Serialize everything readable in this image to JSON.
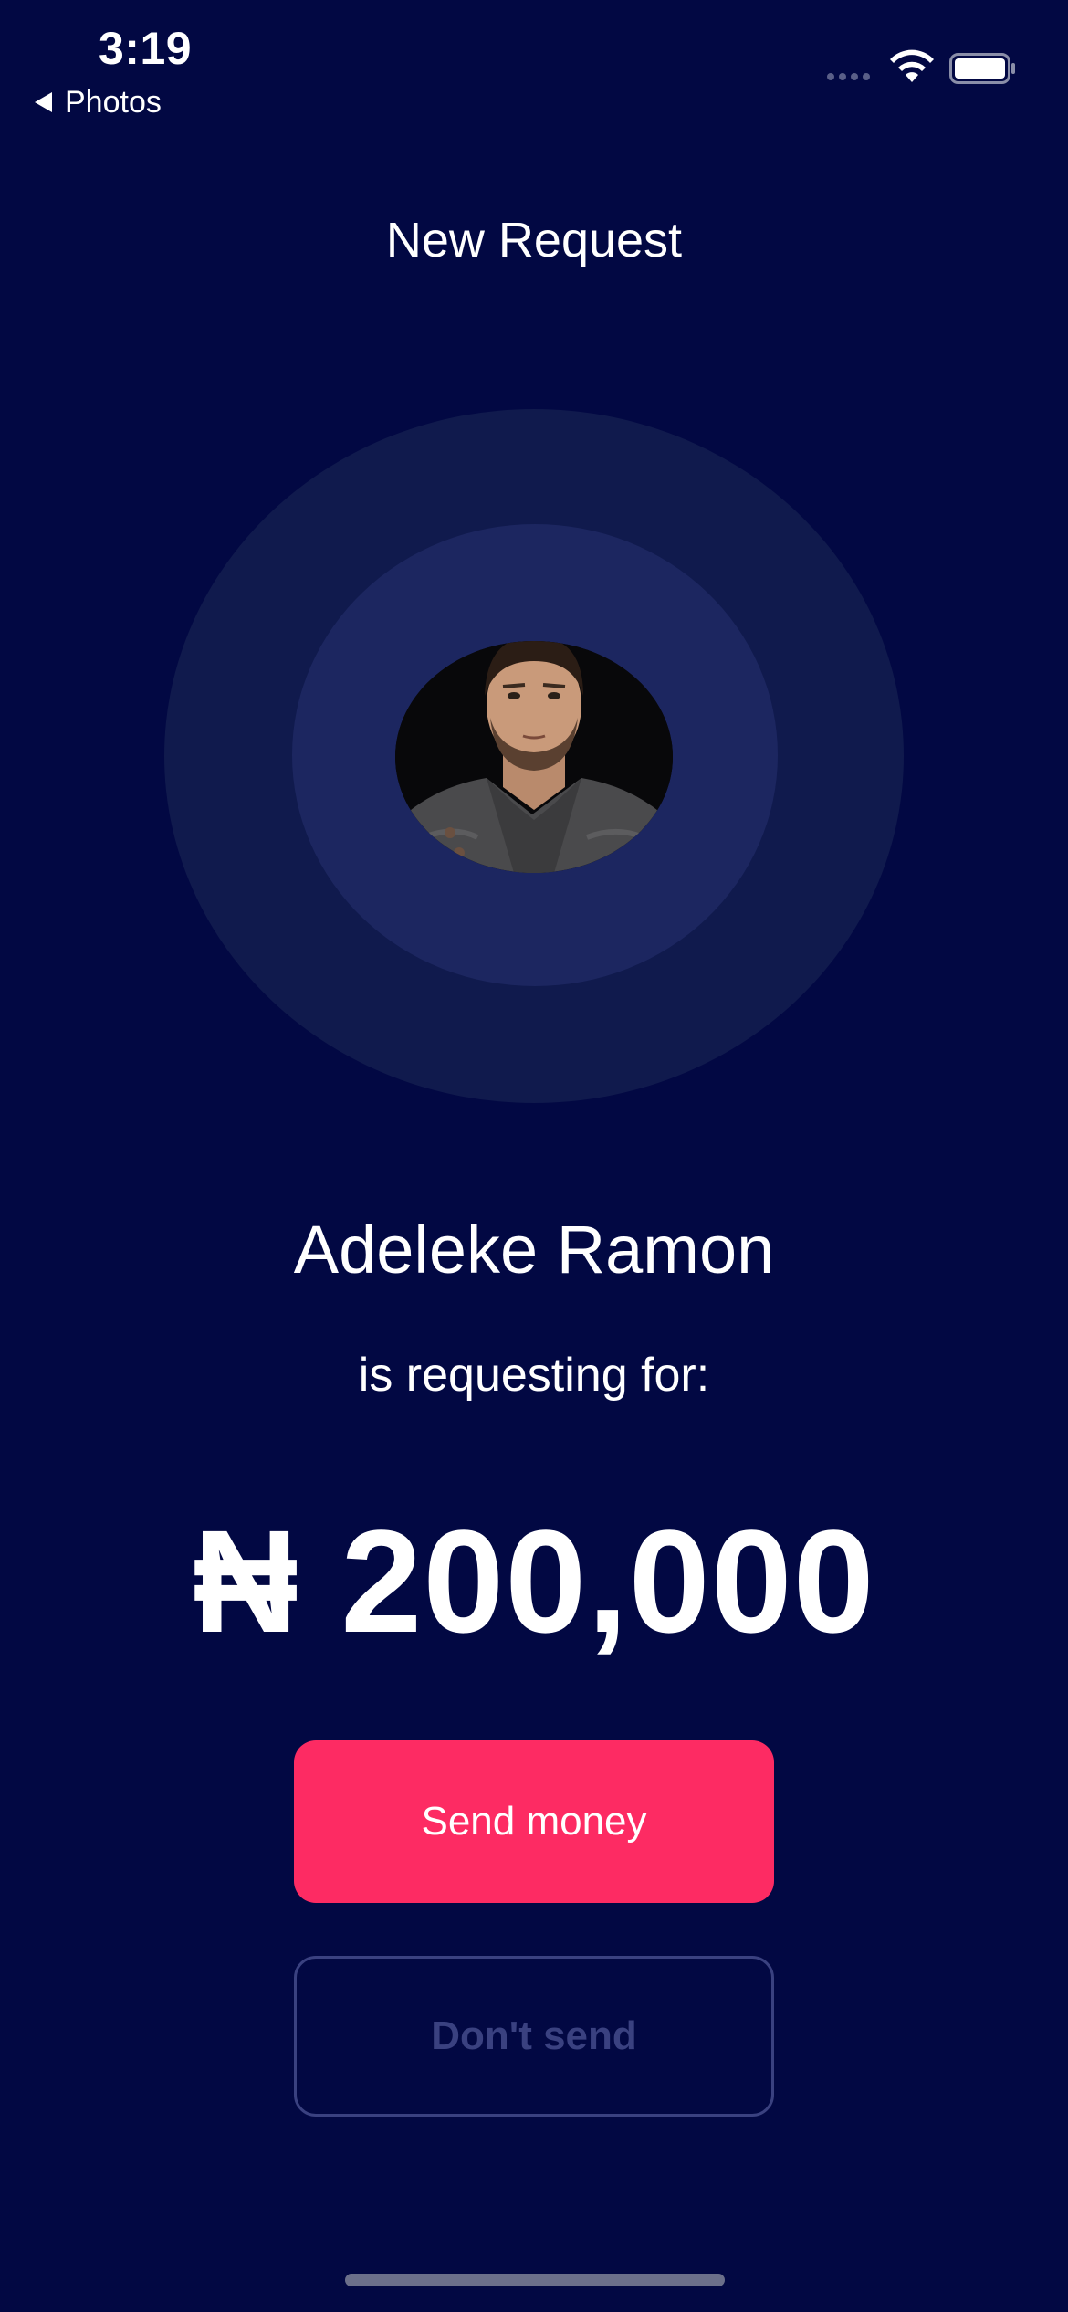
{
  "status_bar": {
    "time": "3:19",
    "back_label": "Photos",
    "signal_icon": "cellular-signal-icon",
    "wifi_icon": "wifi-icon",
    "battery_icon": "battery-icon"
  },
  "header": {
    "title": "New Request"
  },
  "requester": {
    "avatar_icon": "user-avatar-photo",
    "name": "Adeleke Ramon",
    "caption": "is requesting for:",
    "amount": "₦ 200,000"
  },
  "actions": {
    "send_label": "Send money",
    "dont_send_label": "Don't send"
  },
  "colors": {
    "background": "#020843",
    "outer_ring": "#101a4d",
    "inner_ring": "#1c2660",
    "primary_button": "#fd2b63",
    "secondary_button_border": "#3a4180"
  }
}
